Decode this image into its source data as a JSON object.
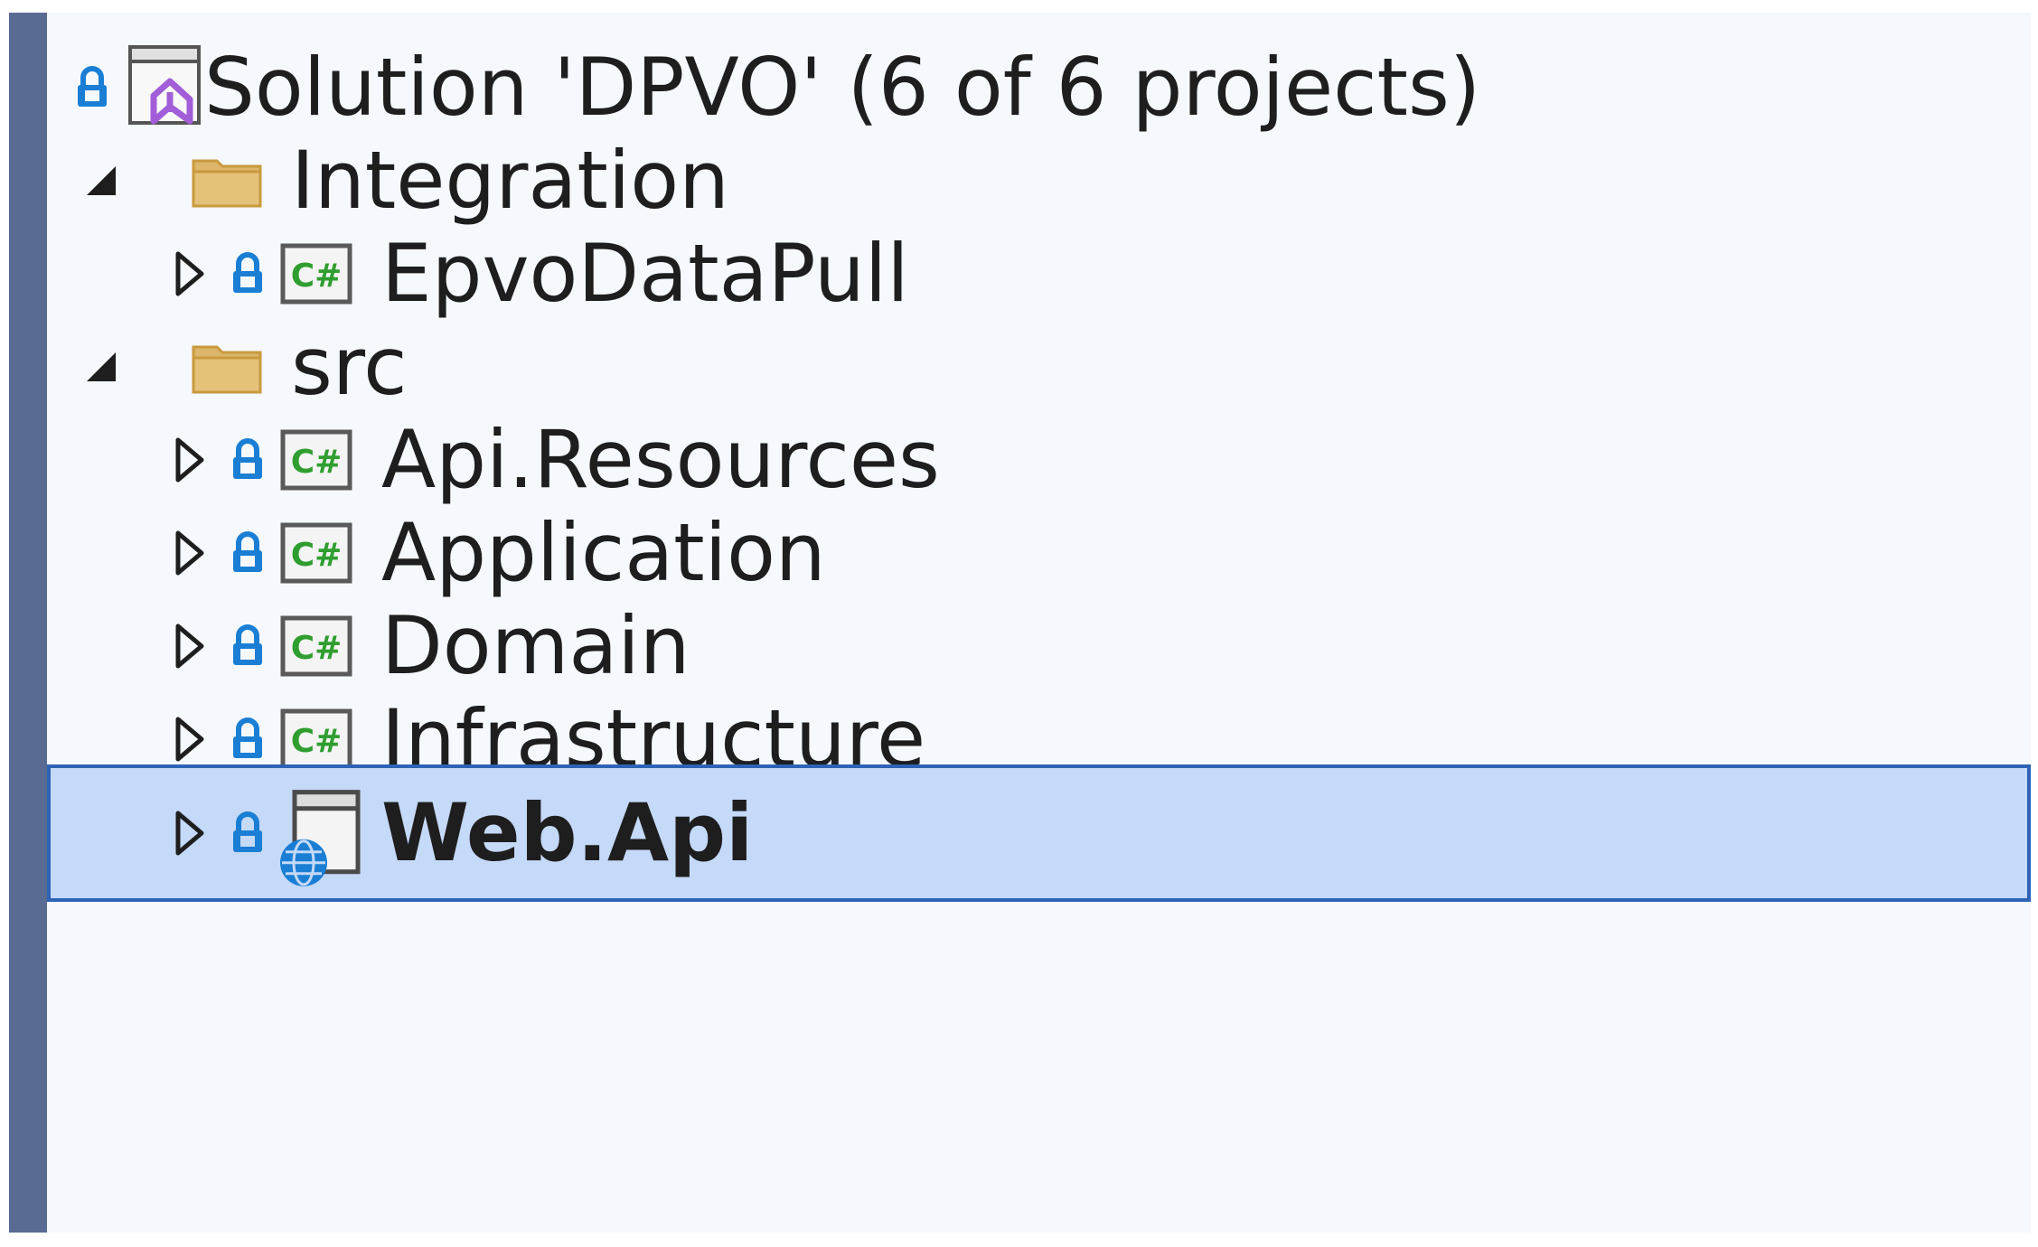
{
  "explorer": {
    "solution": {
      "label": "Solution 'DPVO' (6 of 6 projects)",
      "icon": "visual-studio-solution-icon",
      "lock_icon": "lock-icon"
    },
    "nodes": [
      {
        "kind": "folder",
        "label": "Integration",
        "expanded": true,
        "icon": "folder-icon"
      },
      {
        "kind": "project",
        "label": "EpvoDataPull",
        "expanded": false,
        "icon": "csharp-project-icon"
      },
      {
        "kind": "folder",
        "label": "src",
        "expanded": true,
        "icon": "folder-icon"
      },
      {
        "kind": "project",
        "label": "Api.Resources",
        "expanded": false,
        "icon": "csharp-project-icon"
      },
      {
        "kind": "project",
        "label": "Application",
        "expanded": false,
        "icon": "csharp-project-icon"
      },
      {
        "kind": "project",
        "label": "Domain",
        "expanded": false,
        "icon": "csharp-project-icon"
      },
      {
        "kind": "project",
        "label": "Infrastructure",
        "expanded": false,
        "icon": "csharp-project-icon"
      },
      {
        "kind": "project",
        "label": "Web.Api",
        "expanded": false,
        "selected": true,
        "bold": true,
        "icon": "web-project-icon"
      }
    ],
    "colors": {
      "selection_bg": "#c5d9f8",
      "selection_border": "#2d63b6",
      "lock_blue": "#1a7fd4",
      "folder": "#dcb66b",
      "csharp_green": "#2f9e2f",
      "vs_purple": "#a25ed8",
      "left_bar": "#5a6b93"
    }
  }
}
